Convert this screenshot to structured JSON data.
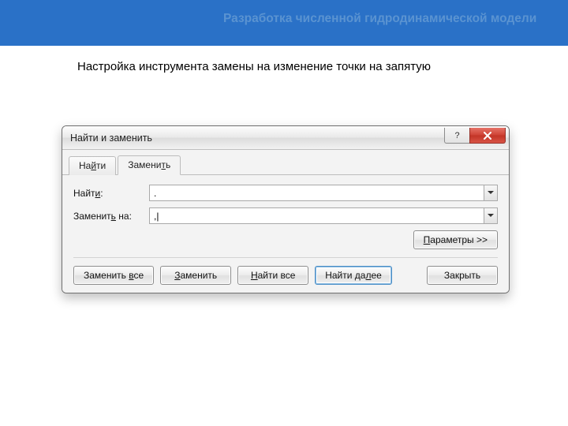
{
  "header": {
    "title": "Разработка численной гидродинамической модели"
  },
  "subtitle": "Настройка инструмента замены на изменение точки на запятую",
  "dialog": {
    "title": "Найти и заменить",
    "tabs": {
      "find_prefix": "На",
      "find_ul": "й",
      "find_suffix": "ти",
      "replace_prefix": "Замени",
      "replace_ul": "т",
      "replace_suffix": "ь"
    },
    "labels": {
      "find_prefix": "Найт",
      "find_ul": "и",
      "find_suffix": ":",
      "replace_prefix": "Заменит",
      "replace_ul": "ь",
      "replace_suffix": " на:"
    },
    "fields": {
      "find_value": ".",
      "replace_value": ",|"
    },
    "buttons": {
      "options_ul": "П",
      "options_rest": "араметры >>",
      "replace_all_prefix": "Заменить ",
      "replace_all_ul": "в",
      "replace_all_suffix": "се",
      "replace_ul": "З",
      "replace_rest": "аменить",
      "find_all_ul": "Н",
      "find_all_rest": "айти все",
      "find_next_prefix": "Найти да",
      "find_next_ul": "л",
      "find_next_suffix": "ее",
      "close": "Закрыть"
    }
  }
}
